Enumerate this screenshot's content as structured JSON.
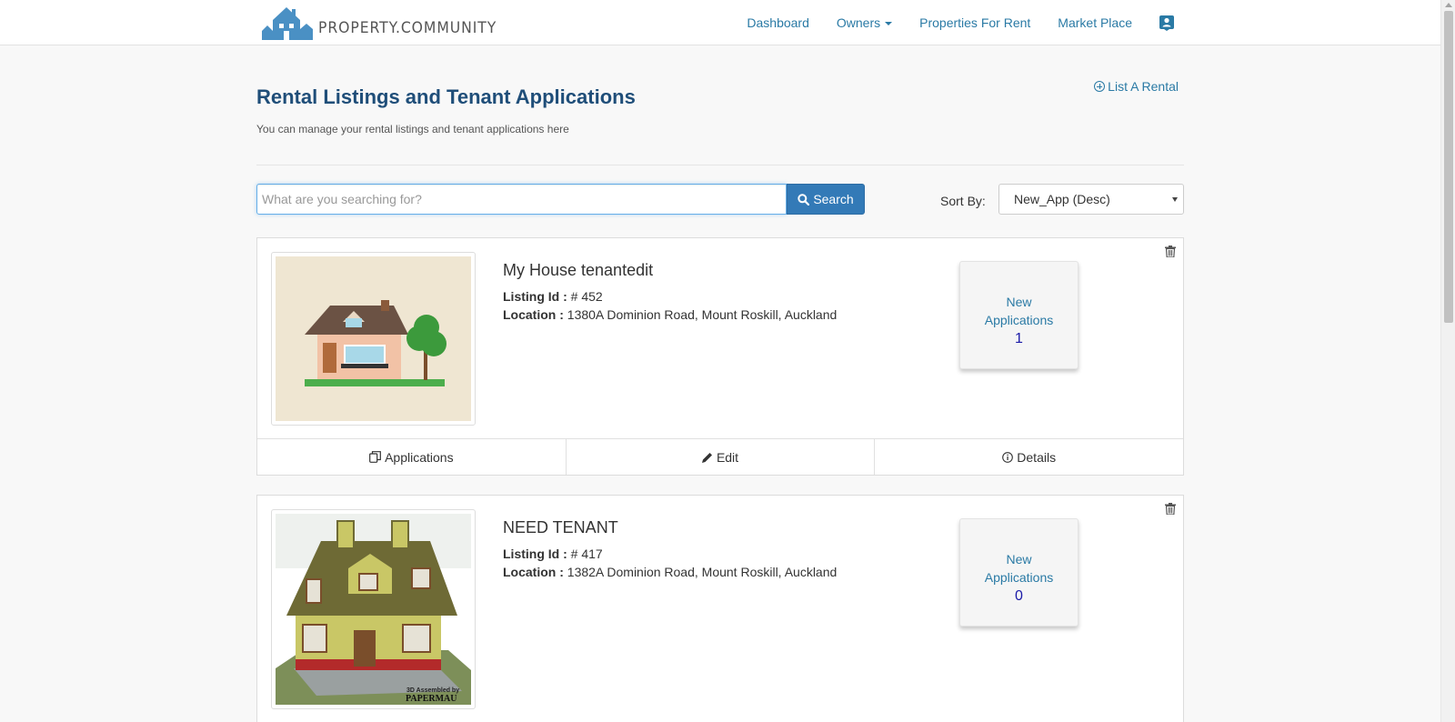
{
  "header": {
    "logo_text": "PROPERTY.COMMUNITY",
    "nav": {
      "dashboard": "Dashboard",
      "owners": "Owners",
      "properties_for_rent": "Properties For Rent",
      "market_place": "Market Place"
    }
  },
  "page": {
    "title": "Rental Listings and Tenant Applications",
    "subtitle": "You can manage your rental listings and tenant applications here",
    "list_rental": "List A Rental"
  },
  "search": {
    "placeholder": "What are you searching for?",
    "button": "Search",
    "sort_label": "Sort By:",
    "sort_value": "New_App (Desc)"
  },
  "listings": [
    {
      "title": "My House tenantedit",
      "id_label": "Listing Id :",
      "id_value": "# 452",
      "location_label": "Location :",
      "location_value": "1380A Dominion Road, Mount Roskill, Auckland",
      "new_label_1": "New",
      "new_label_2": "Applications",
      "new_count": "1",
      "actions": {
        "applications": "Applications",
        "edit": "Edit",
        "details": "Details"
      }
    },
    {
      "title": "NEED TENANT",
      "id_label": "Listing Id :",
      "id_value": "# 417",
      "location_label": "Location :",
      "location_value": "1382A Dominion Road, Mount Roskill, Auckland",
      "new_label_1": "New",
      "new_label_2": "Applications",
      "new_count": "0",
      "image_caption_1": "3D Assembled by",
      "image_caption_2": "PAPERMAU"
    }
  ],
  "colors": {
    "brand": "#4a90c4",
    "link": "#2a7aa5",
    "title": "#1f4e79",
    "primary_button": "#337ab7"
  }
}
